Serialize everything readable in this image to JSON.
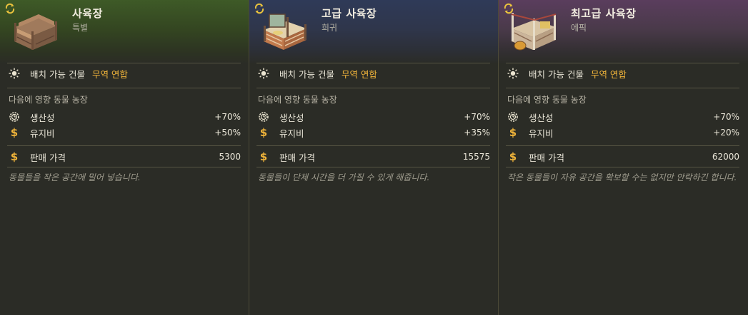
{
  "cards": [
    {
      "title": "사육장",
      "rarity": "특별",
      "placement_label": "배치 가능 건물",
      "placement_value": "무역 연합",
      "affect_label": "다음에 영향 동물 농장",
      "productivity_label": "생산성",
      "productivity_value": "+70%",
      "upkeep_label": "유지비",
      "upkeep_value": "+50%",
      "price_label": "판매 가격",
      "price_value": "5300",
      "description": "동물들을 작은 공간에 밀어 넣습니다."
    },
    {
      "title": "고급 사육장",
      "rarity": "희귀",
      "placement_label": "배치 가능 건물",
      "placement_value": "무역 연합",
      "affect_label": "다음에 영향 동물 농장",
      "productivity_label": "생산성",
      "productivity_value": "+70%",
      "upkeep_label": "유지비",
      "upkeep_value": "+35%",
      "price_label": "판매 가격",
      "price_value": "15575",
      "description": "동물들이 단체 시간을 더 가질 수 있게 해줍니다."
    },
    {
      "title": "최고급 사육장",
      "rarity": "에픽",
      "placement_label": "배치 가능 건물",
      "placement_value": "무역 연합",
      "affect_label": "다음에 영향 동물 농장",
      "productivity_label": "생산성",
      "productivity_value": "+70%",
      "upkeep_label": "유지비",
      "upkeep_value": "+20%",
      "price_label": "판매 가격",
      "price_value": "62000",
      "description": "작은 동물들이 자유 공간을 확보할 수는 없지만 안락하긴 합니다."
    }
  ],
  "icons": {
    "refresh": "refresh-icon",
    "placement": "sun-icon",
    "productivity": "gear-clock-icon",
    "upkeep": "dollar-icon",
    "price": "dollar-icon",
    "building": "animal-pen-icon"
  },
  "colors": {
    "gold": "#f0b43a",
    "special_header": "#3e5a27",
    "rare_header": "#2f3a58",
    "epic_header": "#5a3d5d"
  }
}
